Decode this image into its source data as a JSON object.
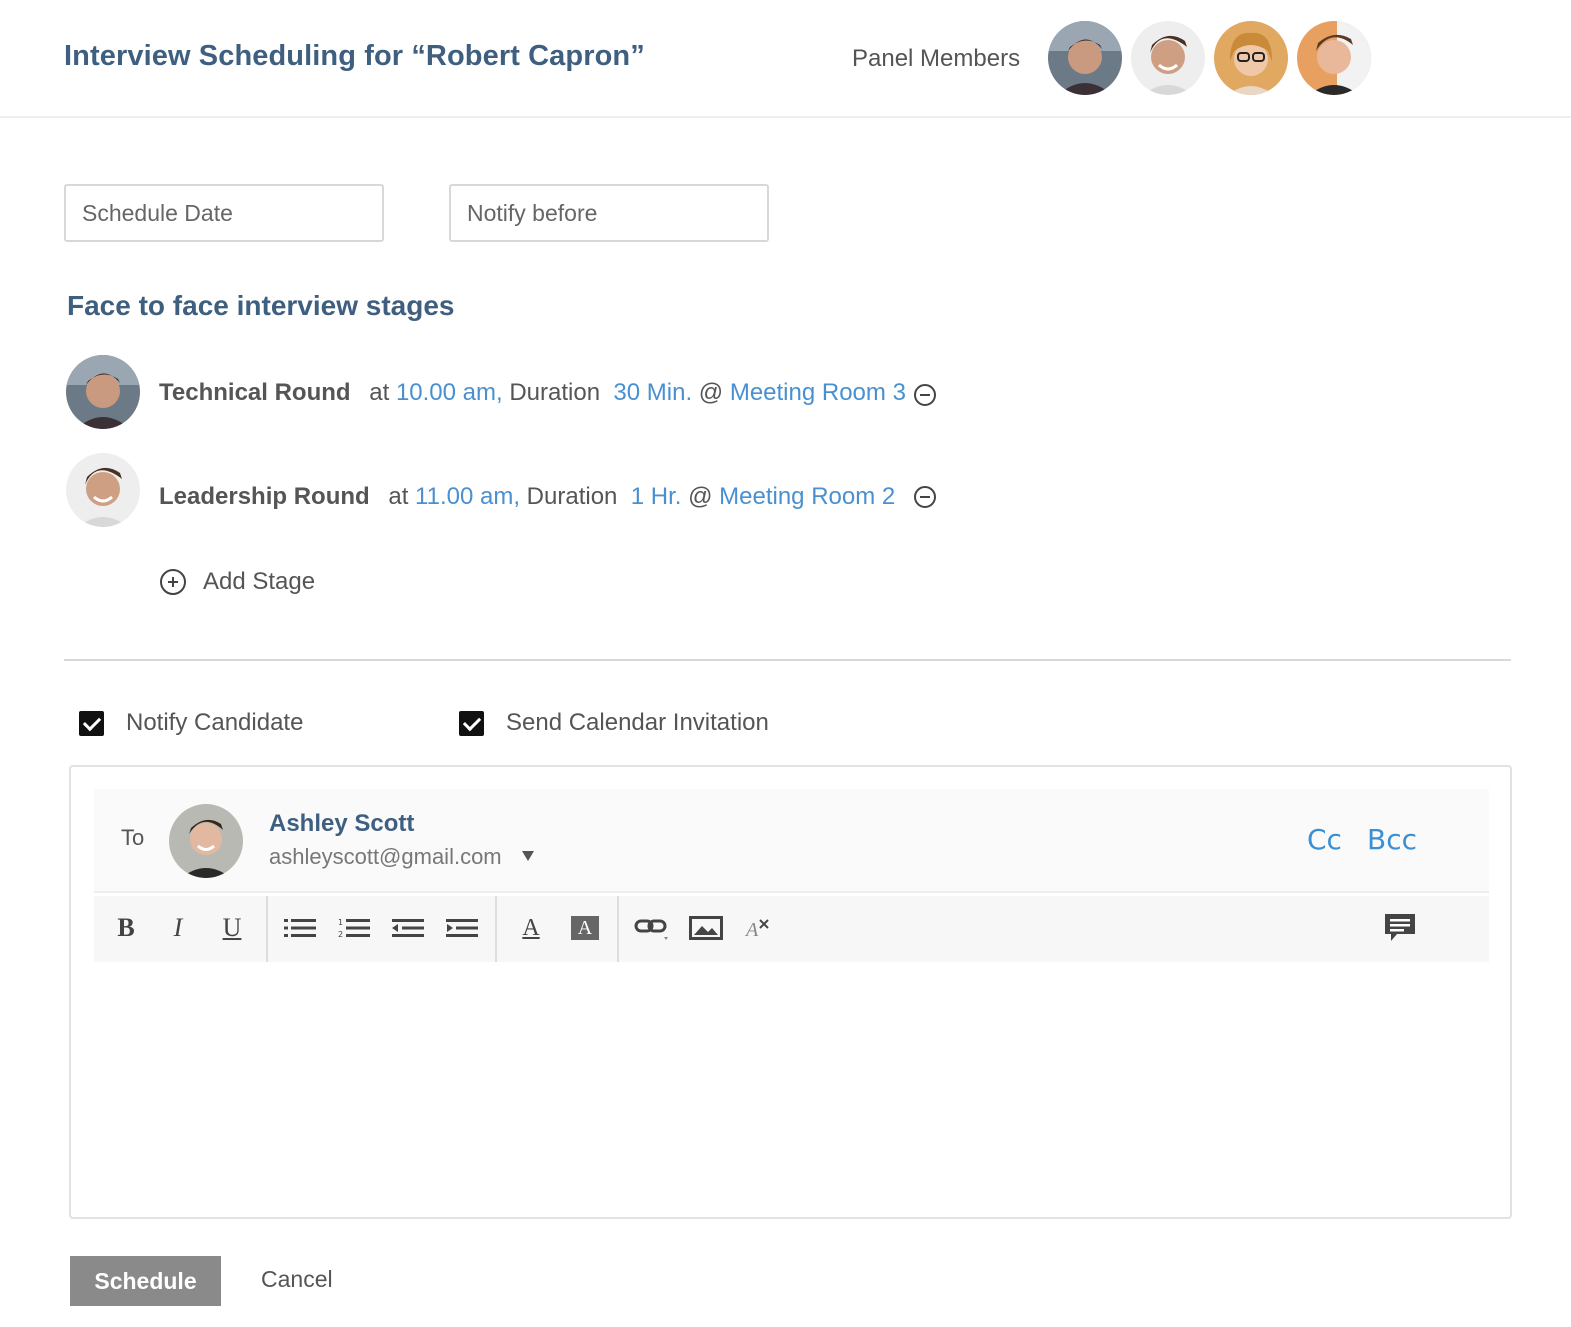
{
  "header": {
    "title": "Interview Scheduling for “Robert Capron”",
    "panel_label": "Panel Members"
  },
  "form": {
    "schedule_date_placeholder": "Schedule Date",
    "notify_before_placeholder": "Notify before"
  },
  "stages_section": {
    "title": "Face to face interview stages",
    "stages": [
      {
        "name": "Technical Round",
        "at_label": "at",
        "time": "10.00 am,",
        "duration_label": "Duration",
        "duration": "30 Min.",
        "at_sign": "@",
        "room": "Meeting Room 3"
      },
      {
        "name": "Leadership Round",
        "at_label": "at",
        "time": "11.00 am,",
        "duration_label": "Duration",
        "duration": "1 Hr.",
        "at_sign": "@",
        "room": "Meeting Room 2"
      }
    ],
    "add_stage_label": "Add Stage"
  },
  "options": {
    "notify_candidate": {
      "label": "Notify Candidate",
      "checked": true
    },
    "send_calendar": {
      "label": "Send Calendar Invitation",
      "checked": true
    }
  },
  "composer": {
    "to_label": "To",
    "recipient_name": "Ashley Scott",
    "recipient_email": "ashleyscott@gmail.com",
    "cc_label": "Cc",
    "bcc_label": "Bcc",
    "toolbar": {
      "bold": "B",
      "italic": "I",
      "underline": "U",
      "font_color": "A",
      "bg_color": "A"
    }
  },
  "actions": {
    "schedule_label": "Schedule",
    "cancel_label": "Cancel"
  },
  "colors": {
    "title": "#3f5f80",
    "link_blue": "#4a90d0",
    "schedule_button": "#8a8a8a"
  }
}
